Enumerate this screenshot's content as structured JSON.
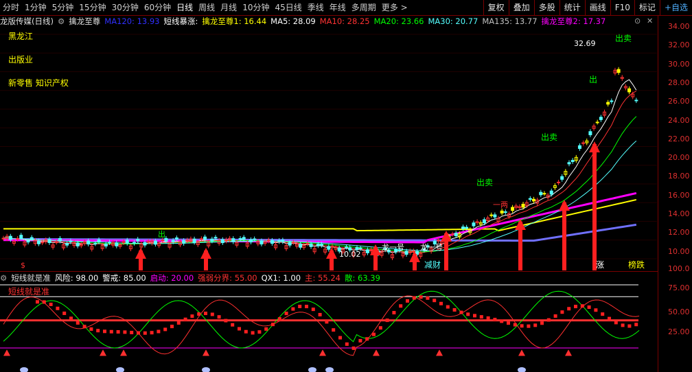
{
  "toolbar": {
    "periods": [
      "分时",
      "1分钟",
      "5分钟",
      "15分钟",
      "30分钟",
      "60分钟",
      "日线",
      "周线",
      "月线",
      "10分钟",
      "45日线",
      "季线",
      "年线",
      "多周期",
      "更多 >"
    ],
    "active_period": "日线",
    "right_buttons": [
      "复权",
      "叠加",
      "多股",
      "统计",
      "画线",
      "F10",
      "标记",
      "+自选"
    ]
  },
  "title": {
    "name": "龙版传媒(日线)",
    "indicator_name": "擒龙至尊",
    "ma120": "MA120: 13.93",
    "short_burst": "短线暴涨:",
    "qlzz1": "擒龙至尊1: 16.44",
    "ma5": "MA5: 28.09",
    "ma10": "MA10: 28.25",
    "ma20": "MA20: 23.66",
    "ma30": "MA30: 20.77",
    "ma135": "MA135: 13.77",
    "qlzz2": "擒龙至尊2: 17.37"
  },
  "overlay_labels": {
    "l1": "黑龙江",
    "l2": "出版业",
    "l3": "新零售 知识产权",
    "high": "32.69",
    "low": "10.02",
    "chu1": "出",
    "chumai1": "出卖",
    "chumai2": "出卖",
    "chumai3": "出卖",
    "chu2": "出",
    "jiancai": "减财",
    "zhang": "涨",
    "bangdie": "榜跌",
    "bang_s": "$",
    "longyihao": "龙一号",
    "blabel": "一两"
  },
  "axis": {
    "main_ticks": [
      "34.00",
      "32.00",
      "30.00",
      "28.00",
      "26.00",
      "24.00",
      "22.00",
      "20.00",
      "18.00",
      "16.00",
      "14.00",
      "12.00",
      "10.00"
    ],
    "sub_ticks": [
      "100.0",
      "75.00",
      "50.00",
      "25.00"
    ]
  },
  "sub_indicator": {
    "name": "短线就是准",
    "risk": "风险: 98.00",
    "alert": "警戒: 85.00",
    "start": "启动: 20.00",
    "strong_weak": "强弱分界: 55.00",
    "qx1": "QX1: 1.00",
    "main": "主: 55.24",
    "retail": "散: 63.39",
    "subtitle": "短线就是准"
  },
  "colors": {
    "up": "#ff3232",
    "down": "#54ffff",
    "ma5": "#ffffff",
    "ma10": "#ff3232",
    "ma20": "#00ff00",
    "ma30": "#54ffff",
    "ma120": "#2020ff",
    "qlzz": "#ff00ff",
    "yellow": "#ffff00"
  }
}
